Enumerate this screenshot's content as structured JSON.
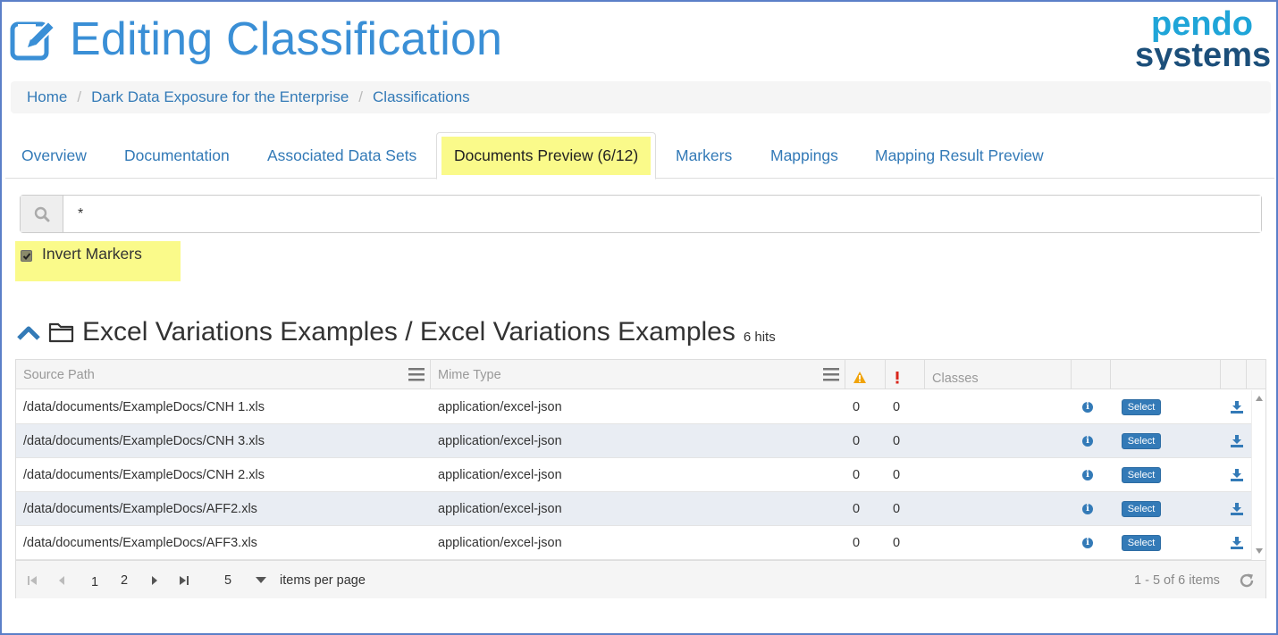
{
  "header": {
    "title": "Editing Classification",
    "logo_line1": "pendo",
    "logo_line2": "systems",
    "brand_color": "#3a8fd6"
  },
  "breadcrumb": [
    "Home",
    "Dark Data Exposure for the Enterprise",
    "Classifications"
  ],
  "tabs": [
    {
      "label": "Overview",
      "active": false
    },
    {
      "label": "Documentation",
      "active": false
    },
    {
      "label": "Associated Data Sets",
      "active": false
    },
    {
      "label": "Documents Preview (6/12)",
      "active": true
    },
    {
      "label": "Markers",
      "active": false
    },
    {
      "label": "Mappings",
      "active": false
    },
    {
      "label": "Mapping Result Preview",
      "active": false
    }
  ],
  "search": {
    "value": "*",
    "icon": "search-icon"
  },
  "invert_markers": {
    "label": "Invert Markers",
    "checked": true
  },
  "section": {
    "title": "Excel Variations Examples / Excel Variations Examples",
    "hits": "6 hits"
  },
  "grid": {
    "columns": [
      "Source Path",
      "Mime Type",
      "warning-icon",
      "error-icon",
      "Classes",
      "",
      "",
      ""
    ],
    "rows": [
      {
        "path": "/data/documents/ExampleDocs/CNH 1.xls",
        "mime": "application/excel-json",
        "warn": "0",
        "err": "0",
        "action": "Select"
      },
      {
        "path": "/data/documents/ExampleDocs/CNH 3.xls",
        "mime": "application/excel-json",
        "warn": "0",
        "err": "0",
        "action": "Select"
      },
      {
        "path": "/data/documents/ExampleDocs/CNH 2.xls",
        "mime": "application/excel-json",
        "warn": "0",
        "err": "0",
        "action": "Select"
      },
      {
        "path": "/data/documents/ExampleDocs/AFF2.xls",
        "mime": "application/excel-json",
        "warn": "0",
        "err": "0",
        "action": "Select"
      },
      {
        "path": "/data/documents/ExampleDocs/AFF3.xls",
        "mime": "application/excel-json",
        "warn": "0",
        "err": "0",
        "action": "Select"
      }
    ]
  },
  "pager": {
    "pages": [
      "1",
      "2"
    ],
    "current_page": "1",
    "page_size": "5",
    "items_per_page_label": "items per page",
    "summary": "1 - 5 of 6 items"
  },
  "colors": {
    "accent": "#337ab7",
    "highlight": "#fafa8a",
    "warning": "#f0a30a",
    "error": "#d9261c"
  }
}
